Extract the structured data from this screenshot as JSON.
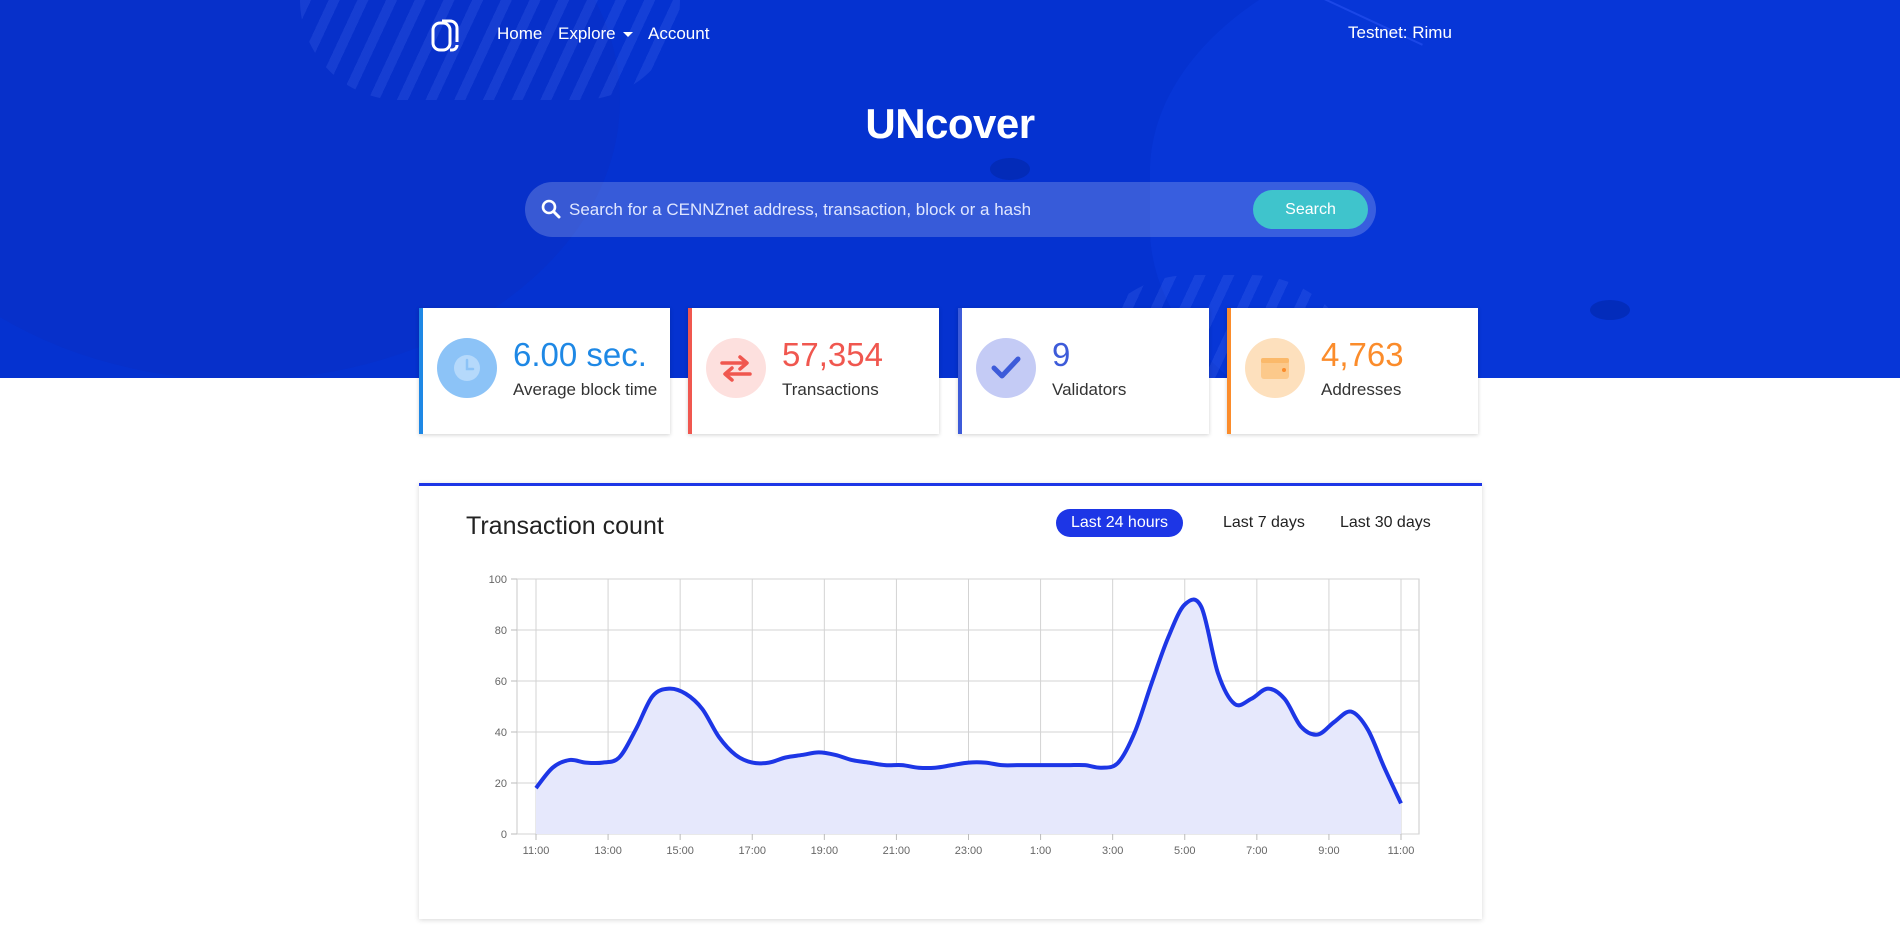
{
  "nav": {
    "home": "Home",
    "explore": "Explore",
    "account": "Account",
    "network": "Testnet: Rimu"
  },
  "hero": {
    "title": "UNcover",
    "search_placeholder": "Search for a CENNZnet address, transaction, block or a hash",
    "search_button": "Search"
  },
  "stats": [
    {
      "value": "6.00 sec.",
      "label": "Average block time",
      "color": "#1e88e5",
      "icon": "clock-icon"
    },
    {
      "value": "57,354",
      "label": "Transactions",
      "color": "#f0574f",
      "icon": "transfer-arrows-icon"
    },
    {
      "value": "9",
      "label": "Validators",
      "color": "#3d5bd9",
      "icon": "checkmark-icon"
    },
    {
      "value": "4,763",
      "label": "Addresses",
      "color": "#fb8c2b",
      "icon": "wallet-icon"
    }
  ],
  "panel": {
    "title": "Transaction count",
    "ranges": [
      "Last 24 hours",
      "Last 7 days",
      "Last 30 days"
    ],
    "active_range": "Last 24 hours"
  },
  "chart_data": {
    "type": "area",
    "title": "",
    "xlabel": "",
    "ylabel": "",
    "ylim": [
      0,
      100
    ],
    "yticks": [
      0,
      20,
      40,
      60,
      80,
      100
    ],
    "x_tick_labels": [
      "11:00",
      "13:00",
      "15:00",
      "17:00",
      "19:00",
      "21:00",
      "23:00",
      "1:00",
      "3:00",
      "5:00",
      "7:00",
      "9:00",
      "11:00"
    ],
    "grid": true,
    "line_color": "#1d36e6",
    "fill_color": "#e6e8fc",
    "series": [
      {
        "values": [
          18,
          26,
          29,
          28,
          28,
          30,
          41,
          54,
          57,
          55,
          49,
          38,
          31,
          28,
          28,
          30,
          31,
          32,
          31,
          29,
          28,
          27,
          27,
          26,
          26,
          27,
          28,
          28,
          27,
          27,
          27,
          27,
          27,
          27,
          26,
          28,
          40,
          59,
          77,
          90,
          89,
          63,
          51,
          53,
          57,
          53,
          42,
          39,
          44,
          48,
          41,
          26,
          12
        ]
      }
    ]
  }
}
